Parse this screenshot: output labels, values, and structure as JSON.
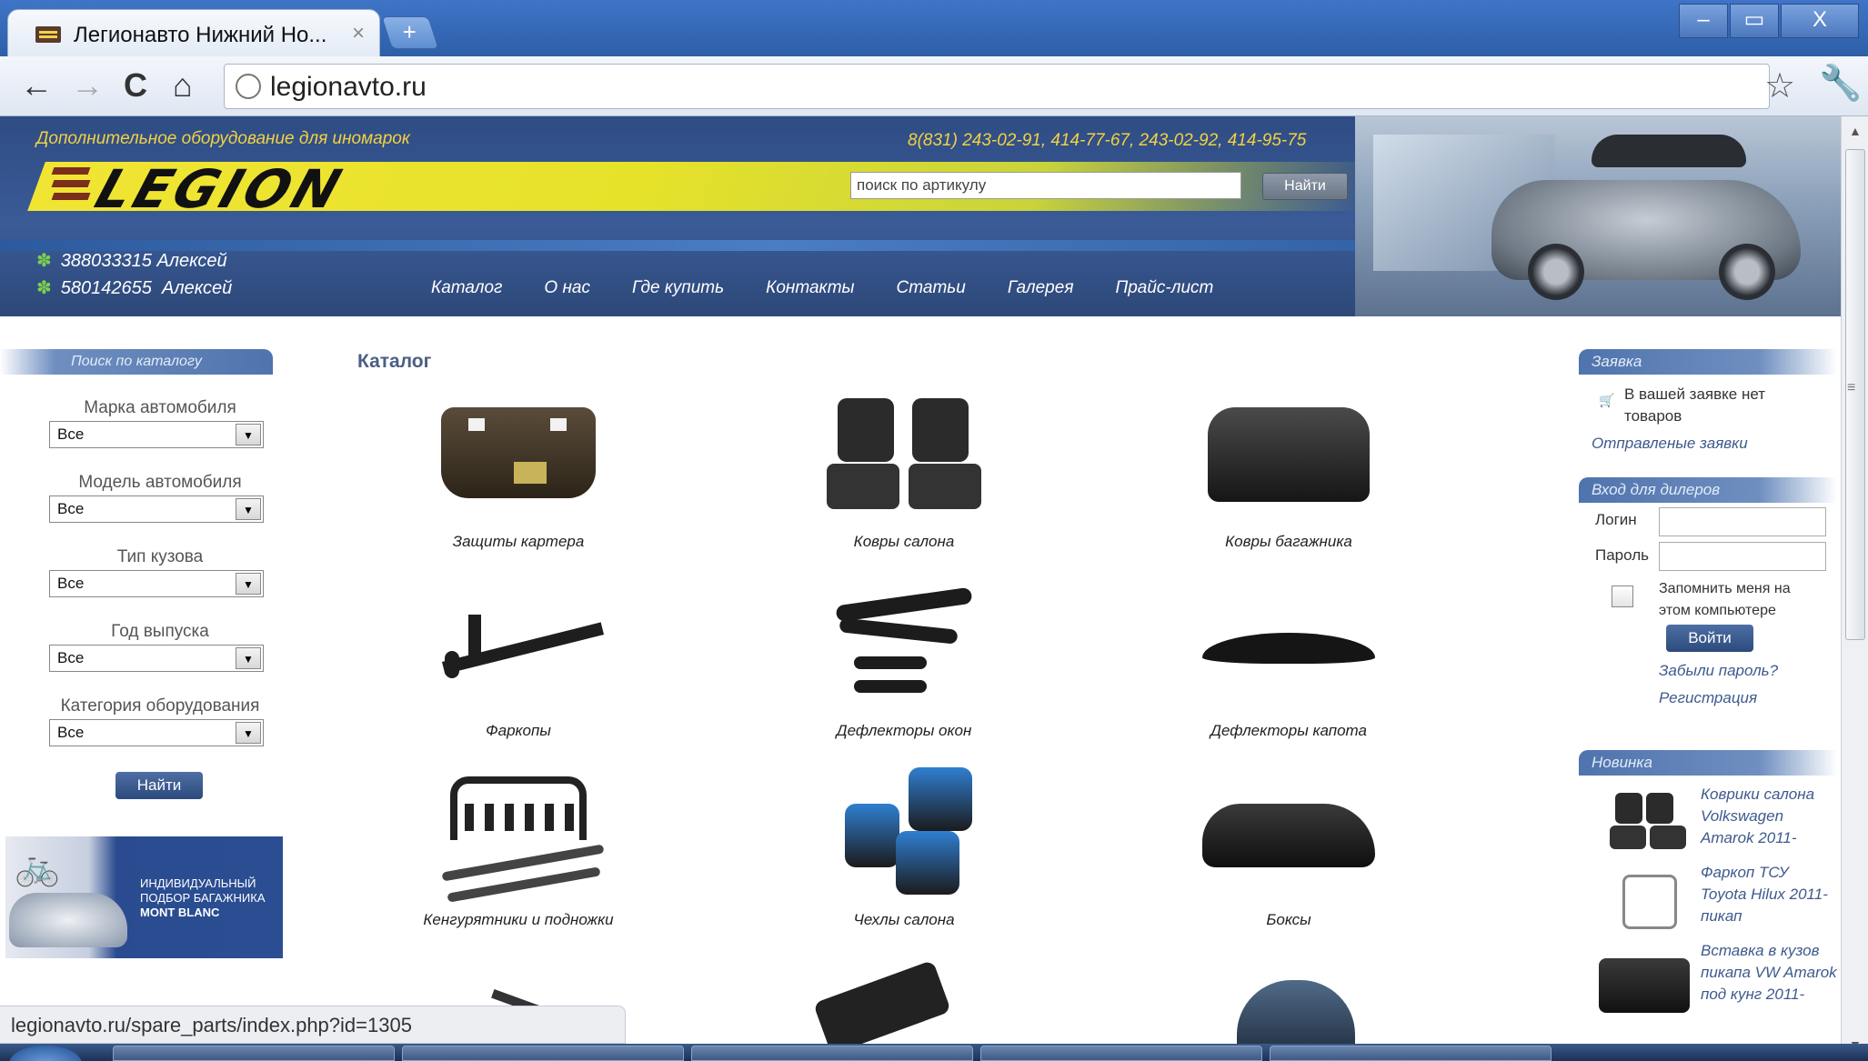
{
  "browser": {
    "tab_title": "Легионавто Нижний Но...",
    "tab_close": "×",
    "new_tab": "+",
    "url": "legionavto.ru",
    "status_url": "legionavto.ru/spare_parts/index.php?id=1305",
    "back": "←",
    "forward": "→",
    "reload": "C",
    "home": "⌂",
    "star": "☆",
    "wrench": "🔧",
    "minimize": "–",
    "maximize": "▭",
    "close": "X"
  },
  "header": {
    "tagline": "Дополнительное оборудование для иномарок",
    "phones": "8(831) 243-02-91, 414-77-67, 243-02-92, 414-95-75",
    "logo": "LEGION",
    "search_placeholder": "поиск по артикулу",
    "search_button": "Найти",
    "icq": [
      {
        "number": "388033315",
        "name": "Алексей"
      },
      {
        "number": "580142655",
        "name": "Алексей"
      }
    ],
    "nav": [
      "Каталог",
      "О нас",
      "Где купить",
      "Контакты",
      "Статьи",
      "Галерея",
      "Прайс-лист"
    ]
  },
  "left": {
    "heading": "Поиск по каталогу",
    "filters": [
      {
        "label": "Марка автомобиля",
        "value": "Все"
      },
      {
        "label": "Модель автомобиля",
        "value": "Все"
      },
      {
        "label": "Тип кузова",
        "value": "Все"
      },
      {
        "label": "Год выпуска",
        "value": "Все"
      },
      {
        "label": "Категория оборудования",
        "value": "Все"
      }
    ],
    "find_button": "Найти",
    "banner_line1": "ИНДИВИДУАЛЬНЫЙ",
    "banner_line2": "ПОДБОР БАГАЖНИКА",
    "banner_line3": "MONT BLANC"
  },
  "catalog": {
    "title": "Каталог",
    "items": [
      {
        "label": "Защиты картера",
        "icon": "crankcase-guard-icon"
      },
      {
        "label": "Ковры салона",
        "icon": "floor-mats-icon"
      },
      {
        "label": "Ковры багажника",
        "icon": "trunk-mat-icon"
      },
      {
        "label": "Фаркопы",
        "icon": "towbar-icon"
      },
      {
        "label": "Дефлекторы окон",
        "icon": "window-deflector-icon"
      },
      {
        "label": "Дефлекторы капота",
        "icon": "hood-deflector-icon"
      },
      {
        "label": "Кенгурятники и подножки",
        "icon": "bullbar-icon"
      },
      {
        "label": "Чехлы салона",
        "icon": "seat-covers-icon"
      },
      {
        "label": "Боксы",
        "icon": "roof-box-icon"
      }
    ]
  },
  "right": {
    "order_heading": "Заявка",
    "order_empty": "В вашей заявке нет товаров",
    "sent_orders": "Отправленые заявки",
    "dealer_heading": "Вход для дилеров",
    "login_label": "Логин",
    "password_label": "Пароль",
    "remember": "Запомнить меня на этом компьютере",
    "login_button": "Войти",
    "forgot": "Забыли пароль?",
    "register": "Регистрация",
    "new_heading": "Новинка",
    "new_items": [
      "Коврики салона Volkswagen Amarok 2011-",
      "Фаркоп ТСУ Toyota Hilux 2011- пикап",
      "Вставка в кузов пикапа VW Amarok под кунг 2011-"
    ]
  },
  "colors": {
    "header_blue": "#3a5b97",
    "accent_yellow": "#f2d240",
    "link_blue": "#3e5a8e",
    "button_blue": "#2c4a7c"
  }
}
